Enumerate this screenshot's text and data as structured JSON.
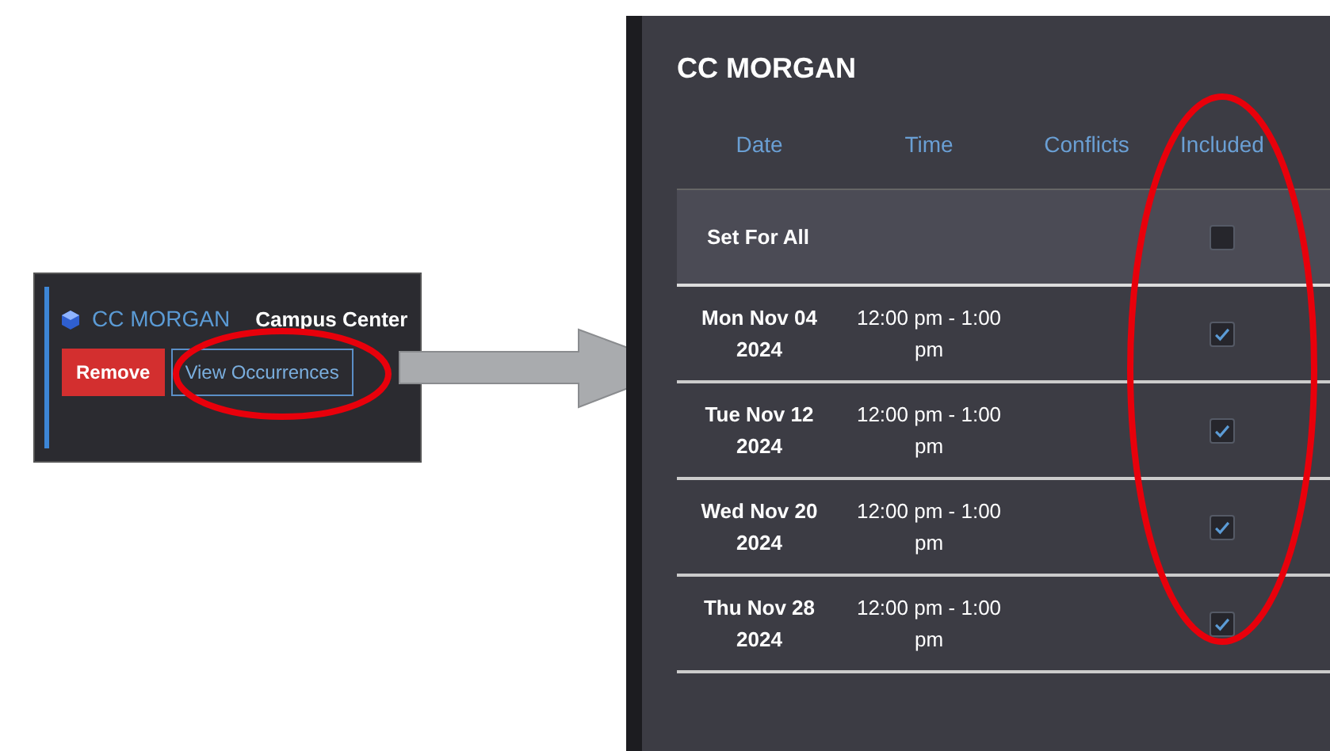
{
  "snippet": {
    "name": "CC MORGAN",
    "location": "Campus Center",
    "buttons": [
      {
        "label": "Remove",
        "kind": "danger"
      },
      {
        "label": "View Occurrences",
        "kind": "outline"
      }
    ]
  },
  "dialog": {
    "title": "CC MORGAN",
    "columns": [
      "Date",
      "Time",
      "Conflicts",
      "Included"
    ],
    "set_all": {
      "label": "Set For All",
      "checked": false
    },
    "rows": [
      {
        "date": "Mon Nov 04 2024",
        "time": "12:00 pm - 1:00 pm",
        "included": true
      },
      {
        "date": "Tue Nov 12 2024",
        "time": "12:00 pm - 1:00 pm",
        "included": true
      },
      {
        "date": "Wed Nov 20 2024",
        "time": "12:00 pm - 1:00 pm",
        "included": true
      },
      {
        "date": "Thu Nov 28 2024",
        "time": "12:00 pm - 1:00 pm",
        "included": true
      }
    ]
  }
}
